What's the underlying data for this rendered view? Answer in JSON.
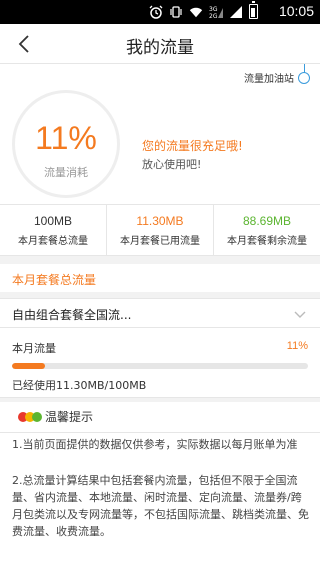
{
  "status_bar": {
    "time": "10:05",
    "icons": [
      "alarm-icon",
      "vibrate-icon",
      "wifi-icon",
      "signal-3g-2g-icon",
      "signal-bars-icon",
      "battery-icon"
    ]
  },
  "header": {
    "title": "我的流量",
    "back_icon": "back-arrow-icon"
  },
  "gauge": {
    "station_label": "流量加油站",
    "percent_text": "11%",
    "percent_value": 11,
    "percent_label": "流量消耗",
    "message_primary": "您的流量很充足哦!",
    "message_secondary": "放心使用吧!"
  },
  "stats": [
    {
      "value": "100MB",
      "label": "本月套餐总流量",
      "color": "#333333"
    },
    {
      "value": "11.30MB",
      "label": "本月套餐已用流量",
      "color": "#f47a20"
    },
    {
      "value": "88.69MB",
      "label": "本月套餐剩余流量",
      "color": "#5cb531"
    }
  ],
  "section": {
    "title": "本月套餐总流量"
  },
  "package": {
    "name": "自由组合套餐全国流...",
    "usage_label": "本月流量",
    "usage_percent_text": "11%",
    "usage_fraction": 0.11,
    "used_text": "已经使用11.30MB/100MB"
  },
  "tips": {
    "title": "温馨提示",
    "items": [
      "1.当前页面提供的数据仅供参考，实际数据以每月账单为准",
      "2.总流量计算结果中包括套餐内流量，包括但不限于全国流量、省内流量、本地流量、闲时流量、定向流量、流量券/跨月包类流以及专网流量等，不包括国际流量、跳档类流量、免费流量、收费流量。"
    ]
  },
  "colors": {
    "accent": "#f47a20",
    "remaining": "#5cb531",
    "station": "#3a9bdc"
  }
}
